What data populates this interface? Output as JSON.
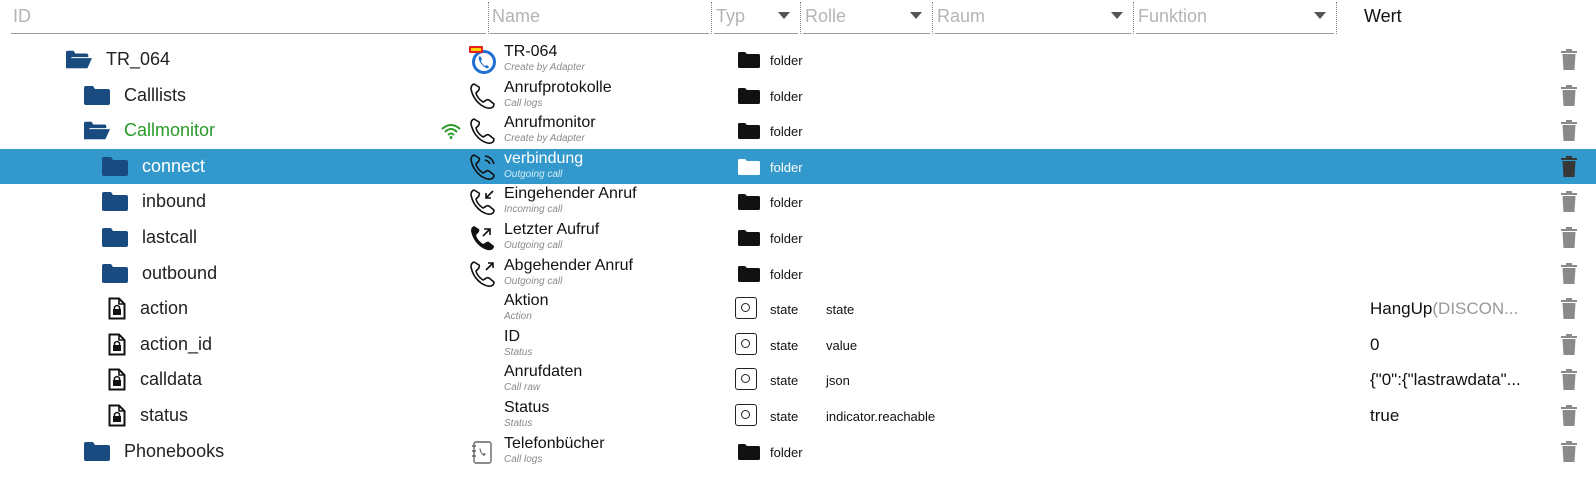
{
  "columns": {
    "id": "ID",
    "name": "Name",
    "type": "Typ",
    "role": "Rolle",
    "room": "Raum",
    "function": "Funktion",
    "value": "Wert"
  },
  "colors": {
    "selected_row": "#3399cc",
    "folder_blue": "#1a4b80",
    "connected_green": "#2a9a2a"
  },
  "rows": [
    {
      "id": "TR_064",
      "name": "TR-064",
      "desc": "Create by Adapter",
      "type": "folder",
      "role": "",
      "value": ""
    },
    {
      "id": "Calllists",
      "name": "Anrufprotokolle",
      "desc": "Call logs",
      "type": "folder",
      "role": "",
      "value": ""
    },
    {
      "id": "Callmonitor",
      "name": "Anrufmonitor",
      "desc": "Create by Adapter",
      "type": "folder",
      "role": "",
      "value": ""
    },
    {
      "id": "connect",
      "name": "verbindung",
      "desc": "Outgoing call",
      "type": "folder",
      "role": "",
      "value": ""
    },
    {
      "id": "inbound",
      "name": "Eingehender Anruf",
      "desc": "Incoming call",
      "type": "folder",
      "role": "",
      "value": ""
    },
    {
      "id": "lastcall",
      "name": "Letzter Aufruf",
      "desc": "Outgoing call",
      "type": "folder",
      "role": "",
      "value": ""
    },
    {
      "id": "outbound",
      "name": "Abgehender Anruf",
      "desc": "Outgoing call",
      "type": "folder",
      "role": "",
      "value": ""
    },
    {
      "id": "action",
      "name": "Aktion",
      "desc": "Action",
      "type": "state",
      "role": "state",
      "value": "HangUp",
      "value_extra": "(DISCON..."
    },
    {
      "id": "action_id",
      "name": "ID",
      "desc": "Status",
      "type": "state",
      "role": "value",
      "value": "0",
      "value_extra": ""
    },
    {
      "id": "calldata",
      "name": "Anrufdaten",
      "desc": "Call raw",
      "type": "state",
      "role": "json",
      "value": "{\"0\":{\"lastrawdata\"...",
      "value_extra": ""
    },
    {
      "id": "status",
      "name": "Status",
      "desc": "Status",
      "type": "state",
      "role": "indicator.reachable",
      "value": "true",
      "value_extra": ""
    },
    {
      "id": "Phonebooks",
      "name": "Telefonbücher",
      "desc": "Call logs",
      "type": "folder",
      "role": "",
      "value": ""
    }
  ]
}
